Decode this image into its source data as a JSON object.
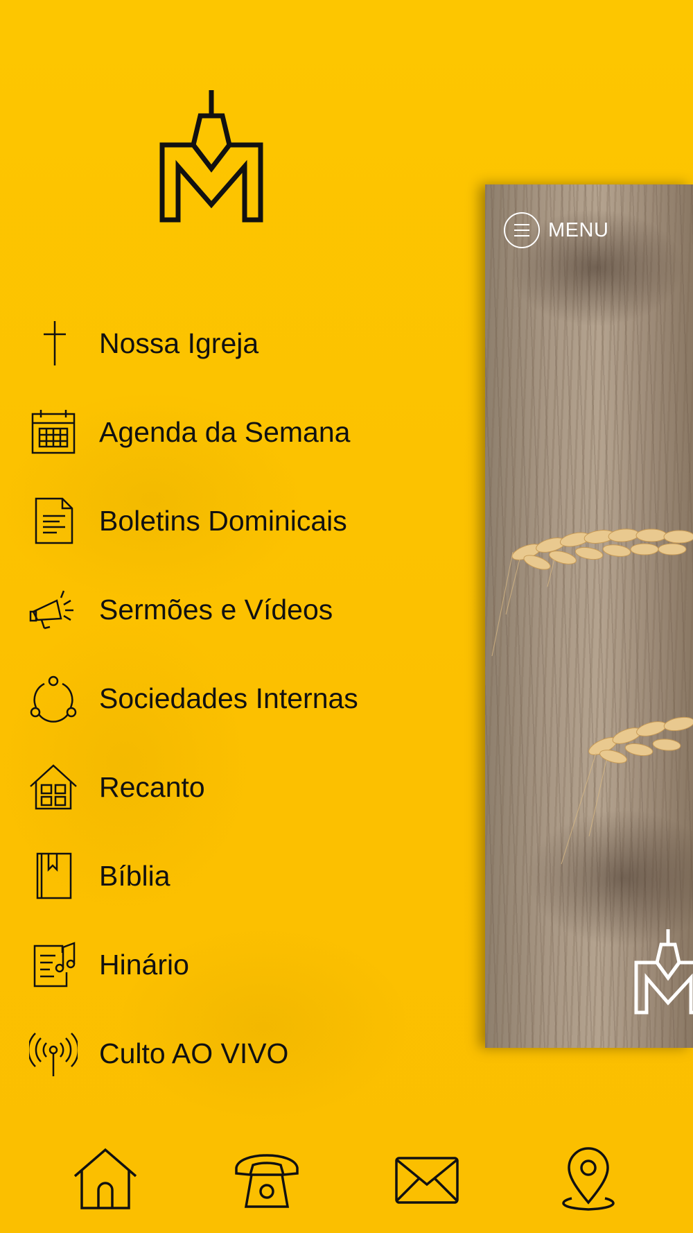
{
  "menu": {
    "items": [
      {
        "label": "Nossa Igreja",
        "icon": "cross-icon"
      },
      {
        "label": "Agenda da Semana",
        "icon": "calendar-icon"
      },
      {
        "label": "Boletins Dominicais",
        "icon": "document-icon"
      },
      {
        "label": "Sermões e Vídeos",
        "icon": "megaphone-icon"
      },
      {
        "label": "Sociedades Internas",
        "icon": "community-icon"
      },
      {
        "label": "Recanto",
        "icon": "house-icon"
      },
      {
        "label": "Bíblia",
        "icon": "bible-icon"
      },
      {
        "label": "Hinário",
        "icon": "hymnal-icon"
      },
      {
        "label": "Culto AO VIVO",
        "icon": "broadcast-icon"
      }
    ]
  },
  "preview": {
    "menu_label": "MENU"
  },
  "bottom_nav": {
    "items": [
      "home-icon",
      "phone-icon",
      "mail-icon",
      "location-icon"
    ]
  },
  "colors": {
    "background": "#fdc300",
    "text": "#111111",
    "preview_text": "#ffffff"
  }
}
